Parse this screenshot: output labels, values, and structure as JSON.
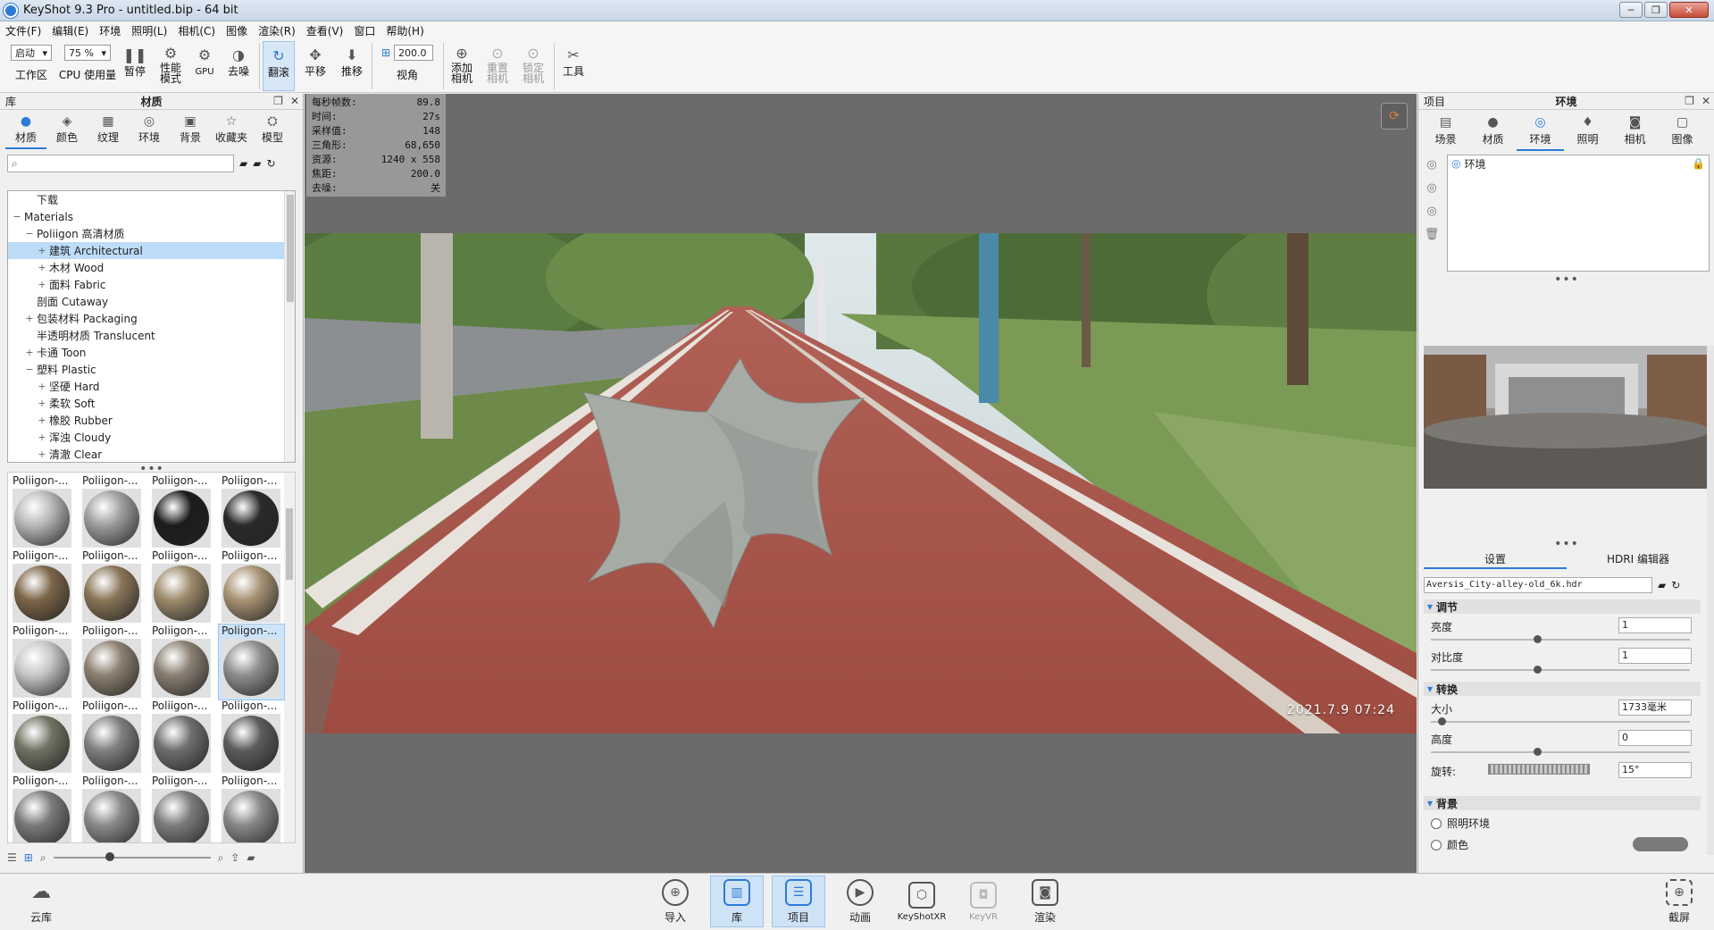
{
  "window": {
    "title": "KeyShot 9.3 Pro  - untitled.bip  - 64 bit",
    "min": "─",
    "max": "❐",
    "close": "✕"
  },
  "menu": [
    "文件(F)",
    "编辑(E)",
    "环境",
    "照明(L)",
    "相机(C)",
    "图像",
    "渲染(R)",
    "查看(V)",
    "窗口",
    "帮助(H)"
  ],
  "toolbar": {
    "workspace_value": "启动",
    "workspace_label": "工作区",
    "cpu_value": "75 %",
    "cpu_label": "CPU 使用量",
    "pause": "暂停",
    "perf_mode": "性能\n模式",
    "gpu": "GPU",
    "denoise": "去噪",
    "tumble": "翻滚",
    "pan": "平移",
    "dolly": "推移",
    "fov_value": "200.0",
    "fov_label": "视角",
    "add_camera": "添加\n相机",
    "reset_camera": "重置\n相机",
    "lock_camera": "锁定\n相机",
    "tools": "工具"
  },
  "library": {
    "panel_label": "库",
    "panel_title": "材质",
    "tabs": [
      "材质",
      "颜色",
      "纹理",
      "环境",
      "背景",
      "收藏夹",
      "模型"
    ],
    "search_placeholder": "",
    "tree": [
      {
        "label": "下载",
        "exp": "",
        "indent": 1
      },
      {
        "label": "Materials",
        "exp": "−",
        "indent": 0
      },
      {
        "label": "Poliigon 高清材质",
        "exp": "−",
        "indent": 1
      },
      {
        "label": "建筑 Architectural",
        "exp": "+",
        "indent": 2,
        "selected": true
      },
      {
        "label": "木材 Wood",
        "exp": "+",
        "indent": 2
      },
      {
        "label": "面料 Fabric",
        "exp": "+",
        "indent": 2
      },
      {
        "label": "剖面 Cutaway",
        "exp": "",
        "indent": 1
      },
      {
        "label": "包装材料 Packaging",
        "exp": "+",
        "indent": 1
      },
      {
        "label": "半透明材质 Translucent",
        "exp": "",
        "indent": 1
      },
      {
        "label": "卡通 Toon",
        "exp": "+",
        "indent": 1
      },
      {
        "label": "塑料 Plastic",
        "exp": "−",
        "indent": 1
      },
      {
        "label": "坚硬 Hard",
        "exp": "+",
        "indent": 2
      },
      {
        "label": "柔软 Soft",
        "exp": "+",
        "indent": 2
      },
      {
        "label": "橡胶 Rubber",
        "exp": "+",
        "indent": 2
      },
      {
        "label": "浑浊 Cloudy",
        "exp": "+",
        "indent": 2
      },
      {
        "label": "清澈 Clear",
        "exp": "+",
        "indent": 2
      }
    ],
    "thumb_label": "Poliigon-...",
    "thumb_colors": [
      "#b8b8b8",
      "#9e9e9e",
      "#1c1c1c",
      "#2a2a2a",
      "#7c6548",
      "#8a7558",
      "#9c8a6a",
      "#a89274",
      "#c6c6c6",
      "#8c8070",
      "#8a7f72",
      "#8e8e8e",
      "#6f7462",
      "#808080",
      "#6e6e6e",
      "#5c5c5c",
      "#7a7a7a",
      "#8a8a8a",
      "#7c7c7c",
      "#888888"
    ],
    "selected_thumb": 11
  },
  "stats": [
    {
      "label": "每秒帧数:",
      "value": "89.8"
    },
    {
      "label": "时间:",
      "value": "27s"
    },
    {
      "label": "采样值:",
      "value": "148"
    },
    {
      "label": "三角形:",
      "value": "68,650"
    },
    {
      "label": "资源:",
      "value": "1240 x 558"
    },
    {
      "label": "焦距:",
      "value": "200.0"
    },
    {
      "label": "去噪:",
      "value": "关"
    }
  ],
  "render": {
    "timestamp": "2021.7.9 07:24"
  },
  "project": {
    "panel_label": "项目",
    "panel_title": "环境",
    "tabs": [
      "场景",
      "材质",
      "环境",
      "照明",
      "相机",
      "图像"
    ],
    "env_item": "环境",
    "sub_tabs": [
      "设置",
      "HDRI 编辑器"
    ],
    "hdri_file": "Aversis_City-alley-old_6k.hdr",
    "sections": {
      "adjust": "调节",
      "transform": "转换",
      "background": "背景"
    },
    "props": [
      {
        "label": "亮度",
        "value": "1",
        "knob": 0.41
      },
      {
        "label": "对比度",
        "value": "1",
        "knob": 0.41
      },
      {
        "label": "大小",
        "value": "1733毫米",
        "knob": 0.03
      },
      {
        "label": "高度",
        "value": "0",
        "knob": 0.41
      }
    ],
    "rotation": {
      "label": "旋转:",
      "value": "15°"
    },
    "radio_lit": "照明环境",
    "radio_color": "颜色"
  },
  "bottombar": {
    "cloud": "云库",
    "import": "导入",
    "library": "库",
    "project": "项目",
    "animation": "动画",
    "keyshotxr": "KeyShotXR",
    "keyvr": "KeyVR",
    "render": "渲染",
    "screenshot": "截屏"
  }
}
